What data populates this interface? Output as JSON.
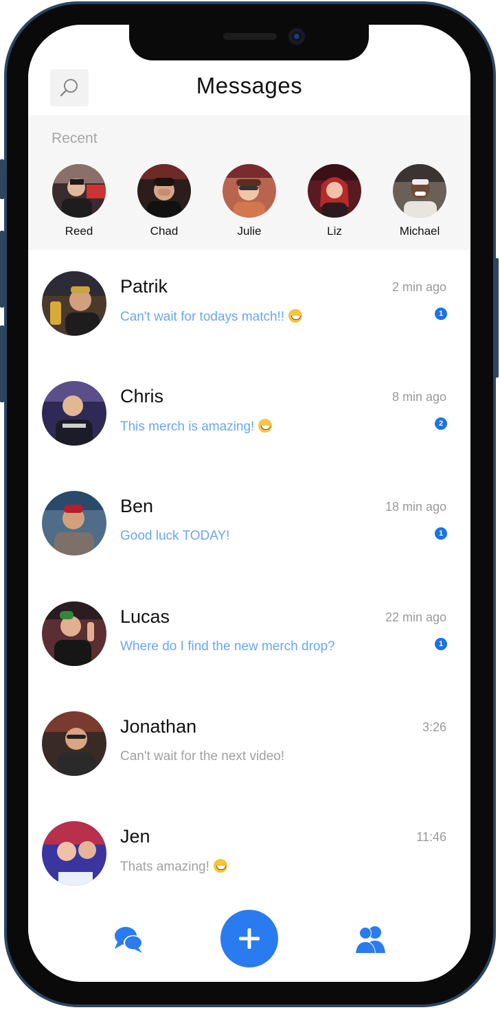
{
  "header": {
    "title": "Messages"
  },
  "recent": {
    "label": "Recent",
    "contacts": [
      {
        "name": "Reed"
      },
      {
        "name": "Chad"
      },
      {
        "name": "Julie"
      },
      {
        "name": "Liz"
      },
      {
        "name": "Michael"
      }
    ]
  },
  "conversations": [
    {
      "name": "Patrik",
      "time": "2 min ago",
      "message": "Can't wait for todays match!!",
      "unread": "1",
      "emoji": "grin-emoji"
    },
    {
      "name": "Chris",
      "time": "8 min ago",
      "message": "This merch is amazing!",
      "unread": "2",
      "emoji": "scream-emoji"
    },
    {
      "name": "Ben",
      "time": "18 min ago",
      "message": "Good luck TODAY!",
      "unread": "1"
    },
    {
      "name": "Lucas",
      "time": "22 min ago",
      "message": "Where do I find the new merch drop?",
      "unread": "1"
    },
    {
      "name": "Jonathan",
      "time": "3:26",
      "message": "Can't wait for the next video!"
    },
    {
      "name": "Jen",
      "time": "11:46",
      "message": "Thats amazing!",
      "emoji": "grin-emoji"
    }
  ],
  "nav": {
    "left_icon": "chat-bubbles-icon",
    "center_icon": "plus-icon",
    "right_icon": "contacts-icon"
  },
  "colors": {
    "accent": "#2a7bf0",
    "badge": "#1a73e8",
    "unread_text": "#6aa6f2",
    "read_text": "#a0a0a0",
    "frame": "#2c4660"
  }
}
